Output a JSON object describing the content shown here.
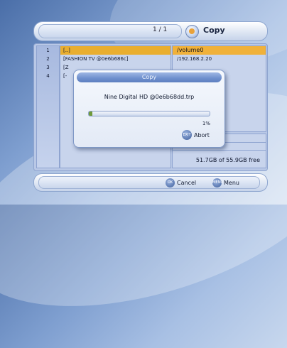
{
  "header": {
    "page_indicator": "1 / 1",
    "title": "Copy",
    "icon": "copy-icon"
  },
  "left_list": {
    "numbers": [
      "1",
      "2",
      "3",
      "4",
      "",
      "",
      "",
      "",
      "",
      "",
      "",
      "",
      "",
      ""
    ],
    "items": [
      "[..]",
      "[FASHION TV @0e6b686c]",
      "[Z",
      "[-",
      "",
      "",
      "",
      "",
      "",
      "",
      "",
      "",
      "",
      ""
    ]
  },
  "right_list": {
    "items": [
      "/volume0",
      "/192.168.2.20",
      "",
      "",
      "",
      "",
      "",
      "",
      "",
      ""
    ]
  },
  "storage": {
    "free_text": "51.7GB of 55.9GB free"
  },
  "dialog": {
    "title": "Copy",
    "filename": "Nine Digital HD @0e6b68dd.trp",
    "progress_percent": 1,
    "progress_label": "1%",
    "abort_button_text": "EXIT",
    "abort_label": "Abort"
  },
  "footer": {
    "cancel_button_text": "OK",
    "cancel_label": "Cancel",
    "menu_button_text": "MENU",
    "menu_label": "Menu"
  },
  "colors": {
    "selection": "#e9ae2f",
    "accent": "#6e8fcd",
    "progress": "#6f9a3a"
  }
}
